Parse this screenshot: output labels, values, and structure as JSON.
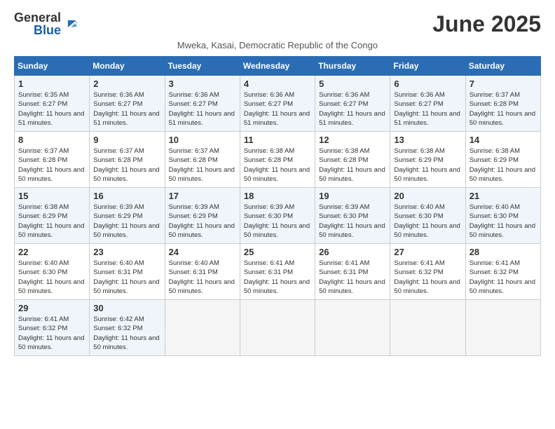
{
  "logo": {
    "general": "General",
    "blue": "Blue"
  },
  "title": "June 2025",
  "subtitle": "Mweka, Kasai, Democratic Republic of the Congo",
  "weekdays": [
    "Sunday",
    "Monday",
    "Tuesday",
    "Wednesday",
    "Thursday",
    "Friday",
    "Saturday"
  ],
  "weeks": [
    [
      {
        "day": "1",
        "sunrise": "6:35 AM",
        "sunset": "6:27 PM",
        "daylight": "11 hours and 51 minutes."
      },
      {
        "day": "2",
        "sunrise": "6:36 AM",
        "sunset": "6:27 PM",
        "daylight": "11 hours and 51 minutes."
      },
      {
        "day": "3",
        "sunrise": "6:36 AM",
        "sunset": "6:27 PM",
        "daylight": "11 hours and 51 minutes."
      },
      {
        "day": "4",
        "sunrise": "6:36 AM",
        "sunset": "6:27 PM",
        "daylight": "11 hours and 51 minutes."
      },
      {
        "day": "5",
        "sunrise": "6:36 AM",
        "sunset": "6:27 PM",
        "daylight": "11 hours and 51 minutes."
      },
      {
        "day": "6",
        "sunrise": "6:36 AM",
        "sunset": "6:27 PM",
        "daylight": "11 hours and 51 minutes."
      },
      {
        "day": "7",
        "sunrise": "6:37 AM",
        "sunset": "6:28 PM",
        "daylight": "11 hours and 50 minutes."
      }
    ],
    [
      {
        "day": "8",
        "sunrise": "6:37 AM",
        "sunset": "6:28 PM",
        "daylight": "11 hours and 50 minutes."
      },
      {
        "day": "9",
        "sunrise": "6:37 AM",
        "sunset": "6:28 PM",
        "daylight": "11 hours and 50 minutes."
      },
      {
        "day": "10",
        "sunrise": "6:37 AM",
        "sunset": "6:28 PM",
        "daylight": "11 hours and 50 minutes."
      },
      {
        "day": "11",
        "sunrise": "6:38 AM",
        "sunset": "6:28 PM",
        "daylight": "11 hours and 50 minutes."
      },
      {
        "day": "12",
        "sunrise": "6:38 AM",
        "sunset": "6:28 PM",
        "daylight": "11 hours and 50 minutes."
      },
      {
        "day": "13",
        "sunrise": "6:38 AM",
        "sunset": "6:29 PM",
        "daylight": "11 hours and 50 minutes."
      },
      {
        "day": "14",
        "sunrise": "6:38 AM",
        "sunset": "6:29 PM",
        "daylight": "11 hours and 50 minutes."
      }
    ],
    [
      {
        "day": "15",
        "sunrise": "6:38 AM",
        "sunset": "6:29 PM",
        "daylight": "11 hours and 50 minutes."
      },
      {
        "day": "16",
        "sunrise": "6:39 AM",
        "sunset": "6:29 PM",
        "daylight": "11 hours and 50 minutes."
      },
      {
        "day": "17",
        "sunrise": "6:39 AM",
        "sunset": "6:29 PM",
        "daylight": "11 hours and 50 minutes."
      },
      {
        "day": "18",
        "sunrise": "6:39 AM",
        "sunset": "6:30 PM",
        "daylight": "11 hours and 50 minutes."
      },
      {
        "day": "19",
        "sunrise": "6:39 AM",
        "sunset": "6:30 PM",
        "daylight": "11 hours and 50 minutes."
      },
      {
        "day": "20",
        "sunrise": "6:40 AM",
        "sunset": "6:30 PM",
        "daylight": "11 hours and 50 minutes."
      },
      {
        "day": "21",
        "sunrise": "6:40 AM",
        "sunset": "6:30 PM",
        "daylight": "11 hours and 50 minutes."
      }
    ],
    [
      {
        "day": "22",
        "sunrise": "6:40 AM",
        "sunset": "6:30 PM",
        "daylight": "11 hours and 50 minutes."
      },
      {
        "day": "23",
        "sunrise": "6:40 AM",
        "sunset": "6:31 PM",
        "daylight": "11 hours and 50 minutes."
      },
      {
        "day": "24",
        "sunrise": "6:40 AM",
        "sunset": "6:31 PM",
        "daylight": "11 hours and 50 minutes."
      },
      {
        "day": "25",
        "sunrise": "6:41 AM",
        "sunset": "6:31 PM",
        "daylight": "11 hours and 50 minutes."
      },
      {
        "day": "26",
        "sunrise": "6:41 AM",
        "sunset": "6:31 PM",
        "daylight": "11 hours and 50 minutes."
      },
      {
        "day": "27",
        "sunrise": "6:41 AM",
        "sunset": "6:32 PM",
        "daylight": "11 hours and 50 minutes."
      },
      {
        "day": "28",
        "sunrise": "6:41 AM",
        "sunset": "6:32 PM",
        "daylight": "11 hours and 50 minutes."
      }
    ],
    [
      {
        "day": "29",
        "sunrise": "6:41 AM",
        "sunset": "6:32 PM",
        "daylight": "11 hours and 50 minutes."
      },
      {
        "day": "30",
        "sunrise": "6:42 AM",
        "sunset": "6:32 PM",
        "daylight": "11 hours and 50 minutes."
      },
      null,
      null,
      null,
      null,
      null
    ]
  ]
}
